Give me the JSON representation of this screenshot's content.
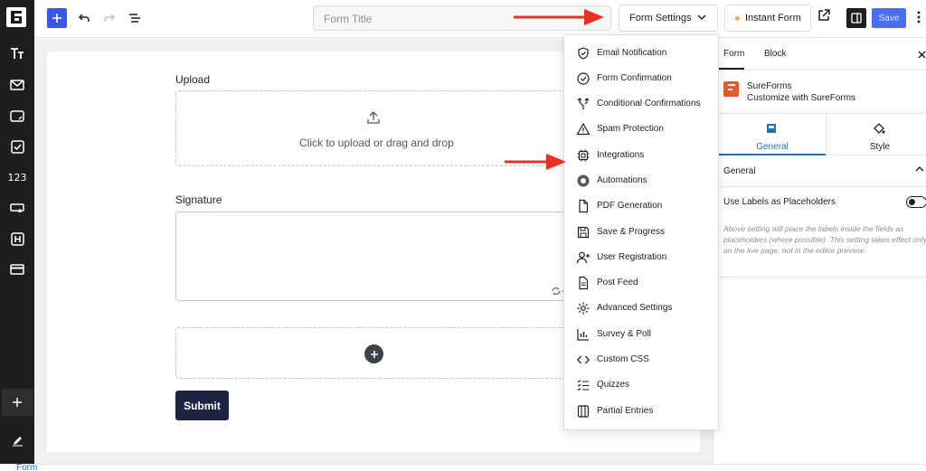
{
  "header": {
    "form_title_placeholder": "Form Title",
    "form_settings_label": "Form Settings",
    "instant_form_label": "Instant Form",
    "save_label": "Save"
  },
  "left_bar": {
    "numeric_icon_label": "123"
  },
  "canvas": {
    "upload_label": "Upload",
    "upload_text": "Click to upload or drag and drop",
    "signature_label": "Signature",
    "submit_label": "Submit"
  },
  "dropdown": {
    "items": [
      {
        "label": "Email Notification",
        "icon": "shield-icon"
      },
      {
        "label": "Form Confirmation",
        "icon": "check-circle-icon"
      },
      {
        "label": "Conditional Confirmations",
        "icon": "branch-icon"
      },
      {
        "label": "Spam Protection",
        "icon": "warning-icon"
      },
      {
        "label": "Integrations",
        "icon": "chip-icon"
      },
      {
        "label": "Automations",
        "icon": "automation-icon"
      },
      {
        "label": "PDF Generation",
        "icon": "file-icon"
      },
      {
        "label": "Save & Progress",
        "icon": "save-icon"
      },
      {
        "label": "User Registration",
        "icon": "user-plus-icon"
      },
      {
        "label": "Post Feed",
        "icon": "document-icon"
      },
      {
        "label": "Advanced Settings",
        "icon": "gear-icon"
      },
      {
        "label": "Survey & Poll",
        "icon": "bar-chart-icon"
      },
      {
        "label": "Custom CSS",
        "icon": "code-icon"
      },
      {
        "label": "Quizzes",
        "icon": "checklist-icon"
      },
      {
        "label": "Partial Entries",
        "icon": "columns-icon"
      }
    ]
  },
  "right_panel": {
    "tab_form": "Form",
    "tab_block": "Block",
    "brand_name": "SureForms",
    "brand_desc": "Customize with SureForms",
    "subtab_general": "General",
    "subtab_style": "Style",
    "section_general": "General",
    "toggle_label": "Use Labels as Placeholders",
    "help_text": "Above setting will place the labels inside the fields as placeholders (where possible). This setting takes effect only on the live page, not in the editor preview."
  },
  "footer": {
    "breadcrumb": "Form"
  },
  "colors": {
    "accent": "#3858e9",
    "brand": "#e35d2c",
    "submit": "#1e2344",
    "arrow": "#e8321f",
    "link": "#2271b1"
  }
}
